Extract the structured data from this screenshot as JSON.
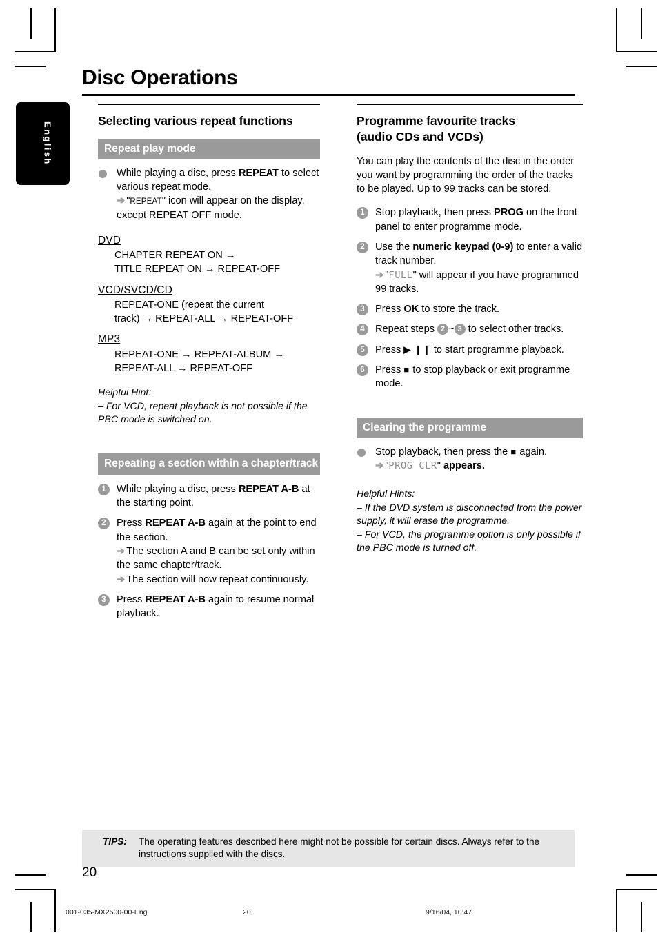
{
  "meta": {
    "language_tab": "English",
    "page_number": "20"
  },
  "header": {
    "title": "Disc Operations"
  },
  "left_column": {
    "section_title": "Selecting various repeat functions",
    "bar_repeat_play": "Repeat play mode",
    "bullet_repeat": {
      "line1_a": "While playing a disc, press ",
      "line1_b": "REPEAT",
      "line1_c": " to select various repeat mode.",
      "arrow": "➔",
      "line2_a": "\"",
      "line2_smallcaps": "REPEAT",
      "line2_b": "\" icon will appear on the display, except REPEAT OFF mode."
    },
    "modes": [
      {
        "name": "DVD",
        "lines": [
          "CHAPTER REPEAT ON →",
          "TITLE REPEAT ON → REPEAT-OFF"
        ]
      },
      {
        "name": "VCD/SVCD/CD",
        "lines": [
          "REPEAT-ONE (repeat the current",
          "track) → REPEAT-ALL → REPEAT-OFF"
        ]
      },
      {
        "name": "MP3",
        "lines": [
          "REPEAT-ONE → REPEAT-ALBUM →",
          "REPEAT-ALL → REPEAT-OFF"
        ]
      }
    ],
    "hint_title": "Helpful Hint:",
    "hint_text": "–  For VCD, repeat playback is not possible if the PBC mode is switched on.",
    "bar_repeating_section": "Repeating a section within a chapter/track",
    "steps": [
      {
        "num": "1",
        "text_a": "While playing a disc, press ",
        "bold": "REPEAT A-B",
        "text_b": " at the starting point."
      },
      {
        "num": "2",
        "text_a": "Press ",
        "bold": "REPEAT A-B",
        "text_b": " again at the point to end the section.",
        "notes": [
          "The section A and B can be set only within the same chapter/track.",
          "The section will now repeat continuously."
        ]
      },
      {
        "num": "3",
        "text_a": "Press ",
        "bold": "REPEAT A-B",
        "text_b": " again to resume normal playback."
      }
    ]
  },
  "right_column": {
    "section_title_line1": "Programme favourite tracks",
    "section_title_line2": "(audio CDs and VCDs)",
    "intro_a": "You can play the contents of the disc in the order you want by programming the order of the tracks to be played. Up to ",
    "intro_underlined": "99",
    "intro_b": " tracks can be stored.",
    "steps": [
      {
        "num": "1",
        "text_a": "Stop playback, then press ",
        "bold": "PROG",
        "text_b": " on the front panel to enter programme mode."
      },
      {
        "num": "2",
        "text_a": "Use the ",
        "bold": "numeric keypad (0-9)",
        "text_b": " to enter a valid track number.",
        "note_quote_open": "\"",
        "note_lcd": "FULL",
        "note_quote_close": "\"",
        "note_text": " will appear if you have programmed 99 tracks."
      },
      {
        "num": "3",
        "text_a": "Press ",
        "bold": "OK",
        "text_b": " to store the track."
      },
      {
        "num": "4",
        "text_a": "Repeat steps ",
        "inline_num_1": "2",
        "tilde": "~",
        "inline_num_2": "3",
        "text_b": " to select other tracks."
      },
      {
        "num": "5",
        "text_a": "Press ",
        "glyph": "▶ ❙❙",
        "text_b": " to start programme playback."
      },
      {
        "num": "6",
        "text_a": "Press ",
        "glyph": "■",
        "text_b": "  to stop playback or exit programme mode."
      }
    ],
    "bar_clearing": "Clearing the programme",
    "clearing_bullet": {
      "text_a": "Stop playback, then press the ",
      "glyph": "■",
      "text_b": "  again.",
      "arrow": "➔",
      "quote_open": "\"",
      "lcd": "PROG CLR",
      "quote_close": "\"",
      "text_c": " appears."
    },
    "hint_title": "Helpful Hints:",
    "hint_1": "–  If the DVD system is disconnected from the power supply, it will erase the programme.",
    "hint_2": "–  For VCD, the programme option is only possible if the PBC mode is turned off."
  },
  "tips": {
    "label": "TIPS:",
    "text": "The operating features described here might not be possible for certain discs.  Always refer to the instructions supplied with the discs."
  },
  "print_footer": {
    "file": "001-035-MX2500-00-Eng",
    "page": "20",
    "date": "9/16/04, 10:47"
  },
  "colors": {
    "bar_gray": "#9a9a9a",
    "tips_bg": "#e6e6e6",
    "lcd_gray": "#8c8c8c"
  }
}
